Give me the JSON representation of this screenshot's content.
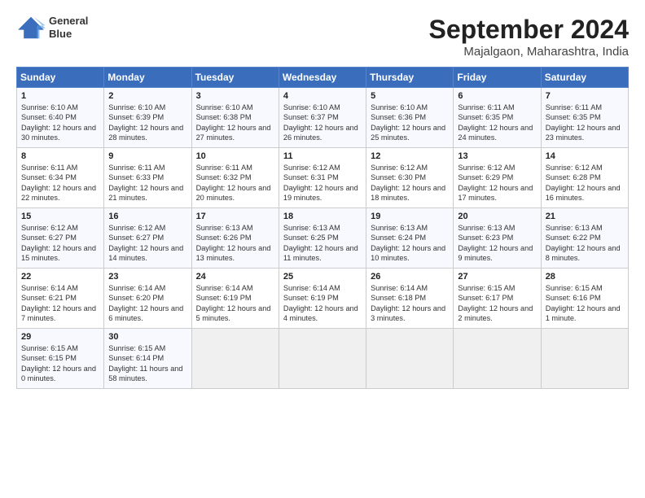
{
  "header": {
    "logo_line1": "General",
    "logo_line2": "Blue",
    "title": "September 2024",
    "subtitle": "Majalgaon, Maharashtra, India"
  },
  "weekdays": [
    "Sunday",
    "Monday",
    "Tuesday",
    "Wednesday",
    "Thursday",
    "Friday",
    "Saturday"
  ],
  "weeks": [
    [
      {
        "day": "1",
        "rise": "6:10 AM",
        "set": "6:40 PM",
        "hours": "12 hours and 30 minutes."
      },
      {
        "day": "2",
        "rise": "6:10 AM",
        "set": "6:39 PM",
        "hours": "12 hours and 28 minutes."
      },
      {
        "day": "3",
        "rise": "6:10 AM",
        "set": "6:38 PM",
        "hours": "12 hours and 27 minutes."
      },
      {
        "day": "4",
        "rise": "6:10 AM",
        "set": "6:37 PM",
        "hours": "12 hours and 26 minutes."
      },
      {
        "day": "5",
        "rise": "6:10 AM",
        "set": "6:36 PM",
        "hours": "12 hours and 25 minutes."
      },
      {
        "day": "6",
        "rise": "6:11 AM",
        "set": "6:35 PM",
        "hours": "12 hours and 24 minutes."
      },
      {
        "day": "7",
        "rise": "6:11 AM",
        "set": "6:35 PM",
        "hours": "12 hours and 23 minutes."
      }
    ],
    [
      {
        "day": "8",
        "rise": "6:11 AM",
        "set": "6:34 PM",
        "hours": "12 hours and 22 minutes."
      },
      {
        "day": "9",
        "rise": "6:11 AM",
        "set": "6:33 PM",
        "hours": "12 hours and 21 minutes."
      },
      {
        "day": "10",
        "rise": "6:11 AM",
        "set": "6:32 PM",
        "hours": "12 hours and 20 minutes."
      },
      {
        "day": "11",
        "rise": "6:12 AM",
        "set": "6:31 PM",
        "hours": "12 hours and 19 minutes."
      },
      {
        "day": "12",
        "rise": "6:12 AM",
        "set": "6:30 PM",
        "hours": "12 hours and 18 minutes."
      },
      {
        "day": "13",
        "rise": "6:12 AM",
        "set": "6:29 PM",
        "hours": "12 hours and 17 minutes."
      },
      {
        "day": "14",
        "rise": "6:12 AM",
        "set": "6:28 PM",
        "hours": "12 hours and 16 minutes."
      }
    ],
    [
      {
        "day": "15",
        "rise": "6:12 AM",
        "set": "6:27 PM",
        "hours": "12 hours and 15 minutes."
      },
      {
        "day": "16",
        "rise": "6:12 AM",
        "set": "6:27 PM",
        "hours": "12 hours and 14 minutes."
      },
      {
        "day": "17",
        "rise": "6:13 AM",
        "set": "6:26 PM",
        "hours": "12 hours and 13 minutes."
      },
      {
        "day": "18",
        "rise": "6:13 AM",
        "set": "6:25 PM",
        "hours": "12 hours and 11 minutes."
      },
      {
        "day": "19",
        "rise": "6:13 AM",
        "set": "6:24 PM",
        "hours": "12 hours and 10 minutes."
      },
      {
        "day": "20",
        "rise": "6:13 AM",
        "set": "6:23 PM",
        "hours": "12 hours and 9 minutes."
      },
      {
        "day": "21",
        "rise": "6:13 AM",
        "set": "6:22 PM",
        "hours": "12 hours and 8 minutes."
      }
    ],
    [
      {
        "day": "22",
        "rise": "6:14 AM",
        "set": "6:21 PM",
        "hours": "12 hours and 7 minutes."
      },
      {
        "day": "23",
        "rise": "6:14 AM",
        "set": "6:20 PM",
        "hours": "12 hours and 6 minutes."
      },
      {
        "day": "24",
        "rise": "6:14 AM",
        "set": "6:19 PM",
        "hours": "12 hours and 5 minutes."
      },
      {
        "day": "25",
        "rise": "6:14 AM",
        "set": "6:19 PM",
        "hours": "12 hours and 4 minutes."
      },
      {
        "day": "26",
        "rise": "6:14 AM",
        "set": "6:18 PM",
        "hours": "12 hours and 3 minutes."
      },
      {
        "day": "27",
        "rise": "6:15 AM",
        "set": "6:17 PM",
        "hours": "12 hours and 2 minutes."
      },
      {
        "day": "28",
        "rise": "6:15 AM",
        "set": "6:16 PM",
        "hours": "12 hours and 1 minute."
      }
    ],
    [
      {
        "day": "29",
        "rise": "6:15 AM",
        "set": "6:15 PM",
        "hours": "12 hours and 0 minutes."
      },
      {
        "day": "30",
        "rise": "6:15 AM",
        "set": "6:14 PM",
        "hours": "11 hours and 58 minutes."
      },
      null,
      null,
      null,
      null,
      null
    ]
  ]
}
